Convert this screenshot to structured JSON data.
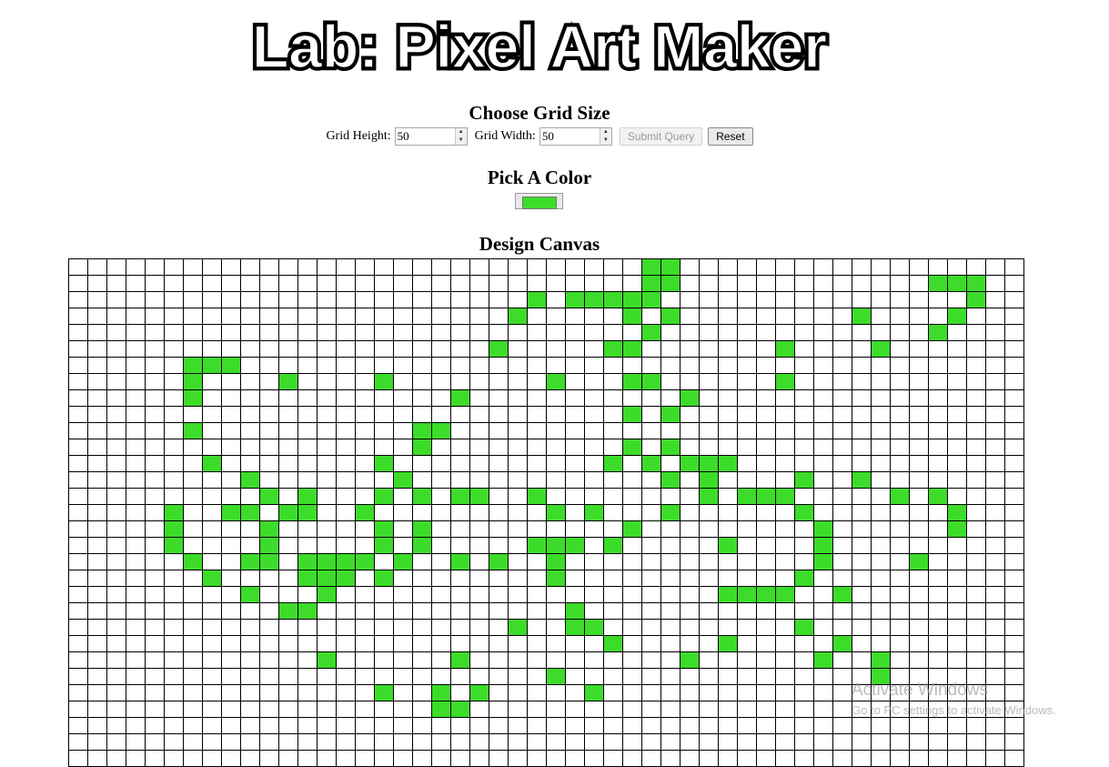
{
  "page": {
    "title": "Lab: Pixel Art Maker",
    "grid_size_heading": "Choose Grid Size",
    "height_label": "Grid Height:",
    "height_value": "50",
    "width_label": "Grid Width:",
    "width_value": "50",
    "submit_label": "Submit Query",
    "reset_label": "Reset",
    "color_heading": "Pick A Color",
    "selected_color": "#3ddc2a",
    "canvas_heading": "Design Canvas"
  },
  "canvas": {
    "visible_rows": 31,
    "visible_cols": 50,
    "cell_empty_color": "#ffffff",
    "filled_cells": [
      [
        0,
        30
      ],
      [
        0,
        31
      ],
      [
        1,
        30
      ],
      [
        1,
        31
      ],
      [
        1,
        45
      ],
      [
        1,
        46
      ],
      [
        1,
        47
      ],
      [
        2,
        24
      ],
      [
        2,
        26
      ],
      [
        2,
        27
      ],
      [
        2,
        28
      ],
      [
        2,
        29
      ],
      [
        2,
        30
      ],
      [
        2,
        47
      ],
      [
        3,
        23
      ],
      [
        3,
        29
      ],
      [
        3,
        31
      ],
      [
        3,
        41
      ],
      [
        3,
        46
      ],
      [
        4,
        30
      ],
      [
        4,
        45
      ],
      [
        5,
        22
      ],
      [
        5,
        28
      ],
      [
        5,
        29
      ],
      [
        5,
        37
      ],
      [
        5,
        42
      ],
      [
        6,
        6
      ],
      [
        6,
        7
      ],
      [
        6,
        8
      ],
      [
        7,
        6
      ],
      [
        7,
        11
      ],
      [
        7,
        16
      ],
      [
        7,
        25
      ],
      [
        7,
        29
      ],
      [
        7,
        30
      ],
      [
        7,
        37
      ],
      [
        8,
        6
      ],
      [
        8,
        20
      ],
      [
        8,
        32
      ],
      [
        9,
        29
      ],
      [
        9,
        31
      ],
      [
        10,
        6
      ],
      [
        10,
        18
      ],
      [
        10,
        19
      ],
      [
        11,
        18
      ],
      [
        11,
        29
      ],
      [
        11,
        31
      ],
      [
        12,
        7
      ],
      [
        12,
        16
      ],
      [
        12,
        28
      ],
      [
        12,
        30
      ],
      [
        12,
        32
      ],
      [
        12,
        33
      ],
      [
        12,
        34
      ],
      [
        13,
        9
      ],
      [
        13,
        17
      ],
      [
        13,
        31
      ],
      [
        13,
        33
      ],
      [
        13,
        38
      ],
      [
        13,
        41
      ],
      [
        14,
        10
      ],
      [
        14,
        12
      ],
      [
        14,
        16
      ],
      [
        14,
        18
      ],
      [
        14,
        20
      ],
      [
        14,
        21
      ],
      [
        14,
        24
      ],
      [
        14,
        33
      ],
      [
        14,
        35
      ],
      [
        14,
        36
      ],
      [
        14,
        37
      ],
      [
        14,
        43
      ],
      [
        14,
        45
      ],
      [
        15,
        5
      ],
      [
        15,
        8
      ],
      [
        15,
        9
      ],
      [
        15,
        11
      ],
      [
        15,
        12
      ],
      [
        15,
        15
      ],
      [
        15,
        25
      ],
      [
        15,
        27
      ],
      [
        15,
        31
      ],
      [
        15,
        38
      ],
      [
        15,
        46
      ],
      [
        16,
        5
      ],
      [
        16,
        10
      ],
      [
        16,
        16
      ],
      [
        16,
        18
      ],
      [
        16,
        29
      ],
      [
        16,
        39
      ],
      [
        16,
        46
      ],
      [
        17,
        5
      ],
      [
        17,
        10
      ],
      [
        17,
        16
      ],
      [
        17,
        18
      ],
      [
        17,
        24
      ],
      [
        17,
        25
      ],
      [
        17,
        26
      ],
      [
        17,
        28
      ],
      [
        17,
        34
      ],
      [
        17,
        39
      ],
      [
        18,
        6
      ],
      [
        18,
        9
      ],
      [
        18,
        10
      ],
      [
        18,
        12
      ],
      [
        18,
        13
      ],
      [
        18,
        14
      ],
      [
        18,
        15
      ],
      [
        18,
        17
      ],
      [
        18,
        20
      ],
      [
        18,
        22
      ],
      [
        18,
        25
      ],
      [
        18,
        39
      ],
      [
        18,
        44
      ],
      [
        19,
        7
      ],
      [
        19,
        12
      ],
      [
        19,
        13
      ],
      [
        19,
        14
      ],
      [
        19,
        16
      ],
      [
        19,
        25
      ],
      [
        19,
        38
      ],
      [
        20,
        9
      ],
      [
        20,
        13
      ],
      [
        20,
        34
      ],
      [
        20,
        35
      ],
      [
        20,
        36
      ],
      [
        20,
        37
      ],
      [
        20,
        40
      ],
      [
        21,
        11
      ],
      [
        21,
        12
      ],
      [
        21,
        26
      ],
      [
        22,
        23
      ],
      [
        22,
        26
      ],
      [
        22,
        27
      ],
      [
        22,
        38
      ],
      [
        23,
        28
      ],
      [
        23,
        34
      ],
      [
        23,
        40
      ],
      [
        24,
        13
      ],
      [
        24,
        20
      ],
      [
        24,
        32
      ],
      [
        24,
        39
      ],
      [
        24,
        42
      ],
      [
        25,
        25
      ],
      [
        25,
        42
      ],
      [
        26,
        16
      ],
      [
        26,
        19
      ],
      [
        26,
        21
      ],
      [
        26,
        27
      ],
      [
        27,
        19
      ],
      [
        27,
        20
      ]
    ]
  },
  "watermark": {
    "line1": "Activate Windows",
    "line2": "Go to PC settings to activate Windows."
  }
}
